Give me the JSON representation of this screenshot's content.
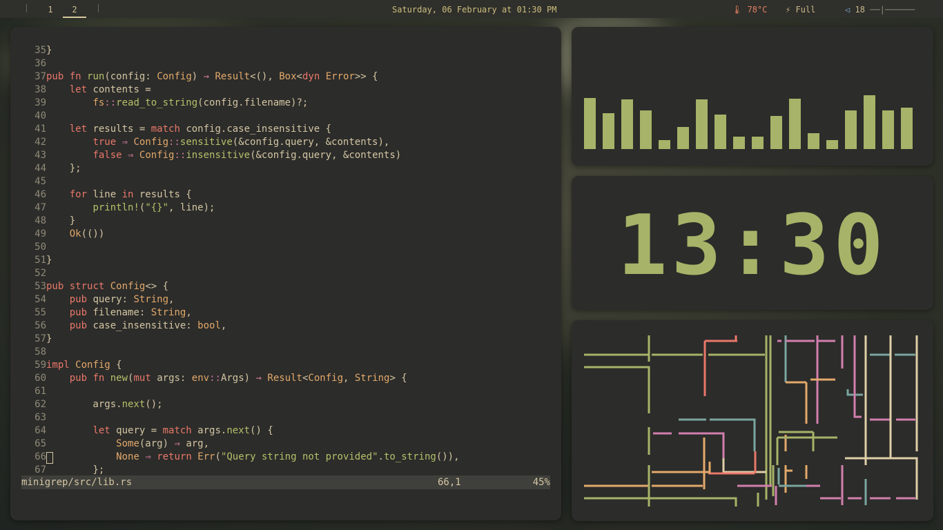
{
  "topbar": {
    "workspaces": [
      "1",
      "2"
    ],
    "active_workspace": "2",
    "date": "Saturday, 06 February at 01:30 PM",
    "temperature": "78°C",
    "battery": "Full",
    "volume": "18",
    "volume_bar": "──|──────"
  },
  "editor": {
    "lines": [
      {
        "n": "35",
        "t": "}"
      },
      {
        "n": "36",
        "t": ""
      },
      {
        "n": "37",
        "t": "pub fn run(config: Config) → Result<(), Box<dyn Error>> {"
      },
      {
        "n": "38",
        "t": "    let contents ="
      },
      {
        "n": "39",
        "t": "        fs::read_to_string(config.filename)?;"
      },
      {
        "n": "40",
        "t": ""
      },
      {
        "n": "41",
        "t": "    let results = match config.case_insensitive {"
      },
      {
        "n": "42",
        "t": "        true ⇒ Config::sensitive(&config.query, &contents),"
      },
      {
        "n": "43",
        "t": "        false ⇒ Config::insensitive(&config.query, &contents)"
      },
      {
        "n": "44",
        "t": "    };"
      },
      {
        "n": "45",
        "t": ""
      },
      {
        "n": "46",
        "t": "    for line in results {"
      },
      {
        "n": "47",
        "t": "        println!(\"{}\", line);"
      },
      {
        "n": "48",
        "t": "    }"
      },
      {
        "n": "49",
        "t": "    Ok(())"
      },
      {
        "n": "50",
        "t": ""
      },
      {
        "n": "51",
        "t": "}"
      },
      {
        "n": "52",
        "t": ""
      },
      {
        "n": "53",
        "t": "pub struct Config<> {"
      },
      {
        "n": "54",
        "t": "    pub query: String,"
      },
      {
        "n": "55",
        "t": "    pub filename: String,"
      },
      {
        "n": "56",
        "t": "    pub case_insensitive: bool,"
      },
      {
        "n": "57",
        "t": "}"
      },
      {
        "n": "58",
        "t": ""
      },
      {
        "n": "59",
        "t": "impl Config {"
      },
      {
        "n": "60",
        "t": "    pub fn new(mut args: env::Args) → Result<Config, String> {"
      },
      {
        "n": "61",
        "t": ""
      },
      {
        "n": "62",
        "t": "        args.next();"
      },
      {
        "n": "63",
        "t": ""
      },
      {
        "n": "64",
        "t": "        let query = match args.next() {"
      },
      {
        "n": "65",
        "t": "            Some(arg) ⇒ arg,"
      },
      {
        "n": "66",
        "t": "            None ⇒ return Err(\"Query string not provided\".to_string()),"
      },
      {
        "n": "67",
        "t": "        };"
      }
    ],
    "status": {
      "file": "minigrep/src/lib.rs",
      "position": "66,1",
      "percent": "45%"
    }
  },
  "visualizer": {
    "bar_color": "#a7b368",
    "levels": [
      0.62,
      0.43,
      0.6,
      0.47,
      0.11,
      0.27,
      0.6,
      0.42,
      0.15,
      0.15,
      0.4,
      0.61,
      0.19,
      0.11,
      0.47,
      0.65,
      0.47,
      0.5
    ]
  },
  "clock": {
    "time": "13:30"
  }
}
